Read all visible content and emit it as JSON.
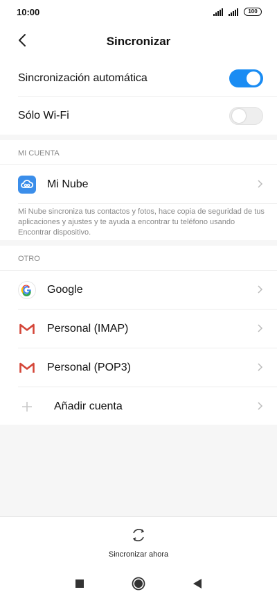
{
  "status_bar": {
    "time": "10:00",
    "battery": "100",
    "signal_icons": [
      "signal-icon",
      "signal-icon"
    ]
  },
  "header": {
    "title": "Sincronizar",
    "back_icon": "chevron-left-icon"
  },
  "settings": {
    "auto_sync": {
      "label": "Sincronización automática",
      "enabled": true
    },
    "wifi_only": {
      "label": "Sólo Wi-Fi",
      "enabled": false
    }
  },
  "my_account": {
    "header": "MI CUENTA",
    "item": {
      "label": "Mi Nube",
      "icon": "cloud-icon"
    },
    "description": "Mi Nube sincroniza tus contactos y fotos, hace copia de seguridad de tus aplicaciones y ajustes y te ayuda a encontrar tu teléfono usando Encontrar dispositivo."
  },
  "other": {
    "header": "OTRO",
    "accounts": [
      {
        "label": "Google",
        "icon": "google-icon"
      },
      {
        "label": "Personal (IMAP)",
        "icon": "gmail-icon"
      },
      {
        "label": "Personal (POP3)",
        "icon": "gmail-icon"
      },
      {
        "label": "Añadir cuenta",
        "icon": "plus-icon"
      }
    ]
  },
  "bottom": {
    "sync_now_label": "Sincronizar ahora",
    "sync_icon": "sync-icon"
  },
  "colors": {
    "accent": "#1a8cf3",
    "background": "#f6f6f6",
    "secondary_text": "#888888",
    "gmail_red": "#d44638"
  }
}
